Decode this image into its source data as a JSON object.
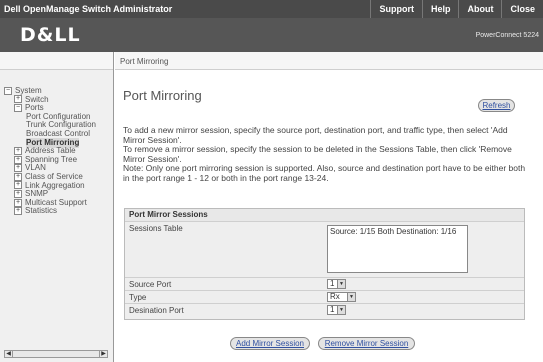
{
  "topbar": {
    "title": "Dell OpenManage Switch Administrator",
    "nav": [
      "Support",
      "Help",
      "About",
      "Close"
    ]
  },
  "header": {
    "logo": "D&LL",
    "product": "PowerConnect 5224"
  },
  "breadcrumb": "Port Mirroring",
  "tree": [
    {
      "label": "System",
      "box": "−"
    },
    {
      "label": "Switch",
      "box": "+"
    },
    {
      "label": "Ports",
      "box": "−"
    },
    {
      "label": "Port Configuration"
    },
    {
      "label": "Trunk Configuration"
    },
    {
      "label": "Broadcast Control"
    },
    {
      "label": "Port Mirroring",
      "selected": true
    },
    {
      "label": "Address Table",
      "box": "+"
    },
    {
      "label": "Spanning Tree",
      "box": "+"
    },
    {
      "label": "VLAN",
      "box": "+"
    },
    {
      "label": "Class of Service",
      "box": "+"
    },
    {
      "label": "Link Aggregation",
      "box": "+"
    },
    {
      "label": "SNMP",
      "box": "+"
    },
    {
      "label": "Multicast Support",
      "box": "+"
    },
    {
      "label": "Statistics",
      "box": "+"
    }
  ],
  "main": {
    "title": "Port Mirroring",
    "refresh": "Refresh",
    "desc": [
      "To add a new mirror session, specify the source port, destination port, and traffic type, then select 'Add Mirror Session'.",
      "To remove a mirror session, specify the session to be deleted in the Sessions Table, then click 'Remove Mirror Session'.",
      "Note: Only one port mirroring session is supported. Also, source and destination port have to be either both in the port range 1 - 12 or both in the port range 13-24."
    ]
  },
  "group": {
    "title": "Port Mirror Sessions",
    "sessions_label": "Sessions Table",
    "sessions_value": "Source: 1/15 Both Destination: 1/16",
    "source_label": "Source Port",
    "source_value": "1",
    "type_label": "Type",
    "type_value": "Rx",
    "dest_label": "Desination Port",
    "dest_value": "1"
  },
  "buttons": {
    "add": "Add Mirror Session",
    "remove": "Remove Mirror Session"
  }
}
